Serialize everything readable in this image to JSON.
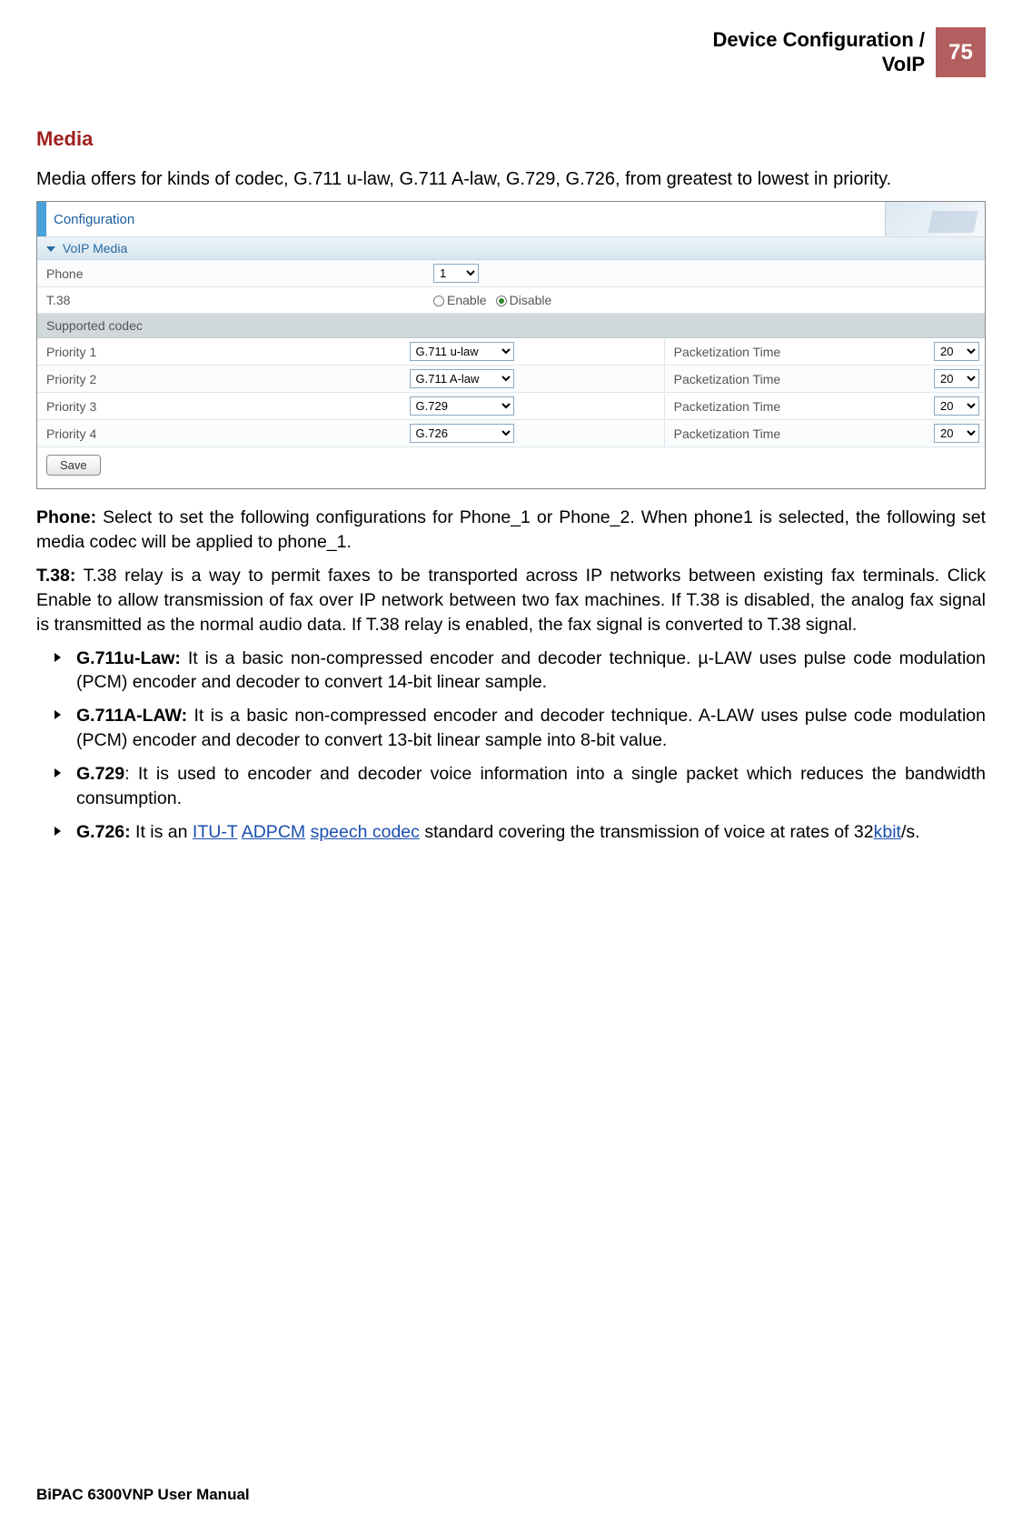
{
  "header": {
    "title_line1": "Device Configuration /",
    "title_line2": "VoIP",
    "page_number": "75"
  },
  "section_title": "Media",
  "intro": "Media offers for kinds of codec, G.711 u-law, G.711 A-law, G.729, G.726, from greatest to lowest in priority.",
  "screenshot": {
    "config_label": "Configuration",
    "band_label": "VoIP Media",
    "phone": {
      "label": "Phone",
      "value": "1"
    },
    "t38": {
      "label": "T.38",
      "enable": "Enable",
      "disable": "Disable",
      "selected": "Disable"
    },
    "supported_codec": "Supported codec",
    "priorities": [
      {
        "label": "Priority 1",
        "codec": "G.711 u-law",
        "ptime_label": "Packetization Time",
        "ptime": "20"
      },
      {
        "label": "Priority 2",
        "codec": "G.711 A-law",
        "ptime_label": "Packetization Time",
        "ptime": "20"
      },
      {
        "label": "Priority 3",
        "codec": "G.729",
        "ptime_label": "Packetization Time",
        "ptime": "20"
      },
      {
        "label": "Priority 4",
        "codec": "G.726",
        "ptime_label": "Packetization Time",
        "ptime": "20"
      }
    ],
    "save": "Save"
  },
  "paragraphs": {
    "phone_bold": "Phone:",
    "phone_text": " Select to set the following configurations for Phone_1 or Phone_2. When phone1 is selected, the following set media codec will be applied to phone_1.",
    "t38_bold": "T.38:",
    "t38_text": " T.38 relay is a way to permit faxes to be transported across IP networks between existing fax terminals. Click Enable to allow transmission of fax over IP network between two fax machines. If T.38 is disabled, the analog fax signal is transmitted as the normal audio data. If T.38 relay is enabled, the fax signal is converted to T.38 signal."
  },
  "bullets": [
    {
      "bold": "G.711u-Law:",
      "text": " It is a basic non-compressed encoder and decoder technique. µ-LAW uses pulse code modulation (PCM) encoder and decoder to convert 14-bit linear sample."
    },
    {
      "bold": "G.711A-LAW:",
      "text": " It is a basic non-compressed encoder and decoder technique. A-LAW uses pulse code modulation (PCM) encoder and decoder to convert 13-bit linear sample into 8-bit value."
    },
    {
      "bold": "G.729",
      "text": ": It is used to encoder and decoder voice information into a single packet which reduces the bandwidth consumption."
    }
  ],
  "g726": {
    "bold": "G.726:",
    "pre": " It is an ",
    "link1": "ITU-T",
    "mid1": " ",
    "link2": "ADPCM",
    "mid2": " ",
    "link3": "speech codec",
    "mid3": " standard covering the transmission of voice at rates of 32",
    "link4": "kbit",
    "post": "/s."
  },
  "footer": "BiPAC 6300VNP User Manual"
}
